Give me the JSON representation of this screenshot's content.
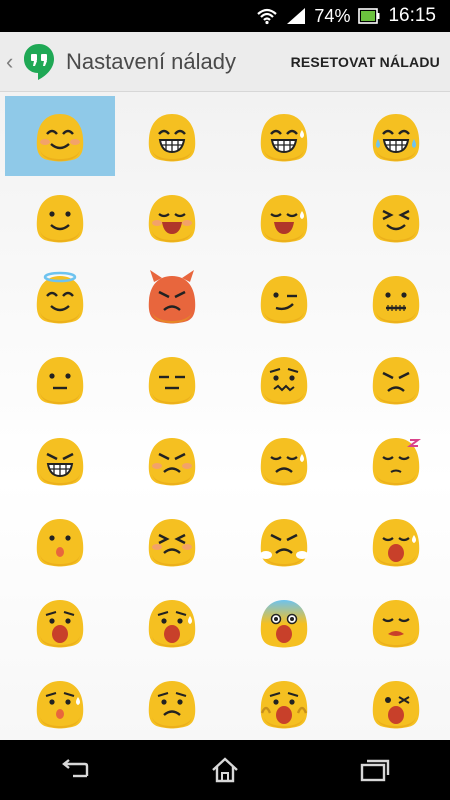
{
  "status_bar": {
    "battery_percent": "74%",
    "time": "16:15",
    "icons": [
      "wifi-icon",
      "signal-icon",
      "battery-icon"
    ]
  },
  "action_bar": {
    "title": "Nastavení nálady",
    "reset_label": "RESETOVAT NÁLADU",
    "app_icon": "hangouts-icon"
  },
  "moods": [
    {
      "name": "smile-blush-selected",
      "selected": true
    },
    {
      "name": "grin"
    },
    {
      "name": "big-grin"
    },
    {
      "name": "tears-of-joy"
    },
    {
      "name": "smile"
    },
    {
      "name": "laugh-blush"
    },
    {
      "name": "laugh-sweat"
    },
    {
      "name": "squint-laugh"
    },
    {
      "name": "angel"
    },
    {
      "name": "devil"
    },
    {
      "name": "wink"
    },
    {
      "name": "zipper-mouth"
    },
    {
      "name": "neutral"
    },
    {
      "name": "expressionless"
    },
    {
      "name": "confused"
    },
    {
      "name": "angry"
    },
    {
      "name": "grimace-angry"
    },
    {
      "name": "pouting"
    },
    {
      "name": "disappointed-sweat"
    },
    {
      "name": "sleepy"
    },
    {
      "name": "surprised"
    },
    {
      "name": "persevere"
    },
    {
      "name": "steam-angry"
    },
    {
      "name": "tired"
    },
    {
      "name": "anguished"
    },
    {
      "name": "fearful"
    },
    {
      "name": "scream"
    },
    {
      "name": "weary"
    },
    {
      "name": "cold-sweat"
    },
    {
      "name": "worried"
    },
    {
      "name": "cheeks-scream"
    },
    {
      "name": "dizzy-shout"
    }
  ],
  "colors": {
    "blob": "#f5c021",
    "blob_shadow": "#e3a318",
    "selected_bg": "#8fc9e8",
    "devil": "#e8663d"
  },
  "nav": [
    "back-icon",
    "home-icon",
    "recents-icon"
  ]
}
